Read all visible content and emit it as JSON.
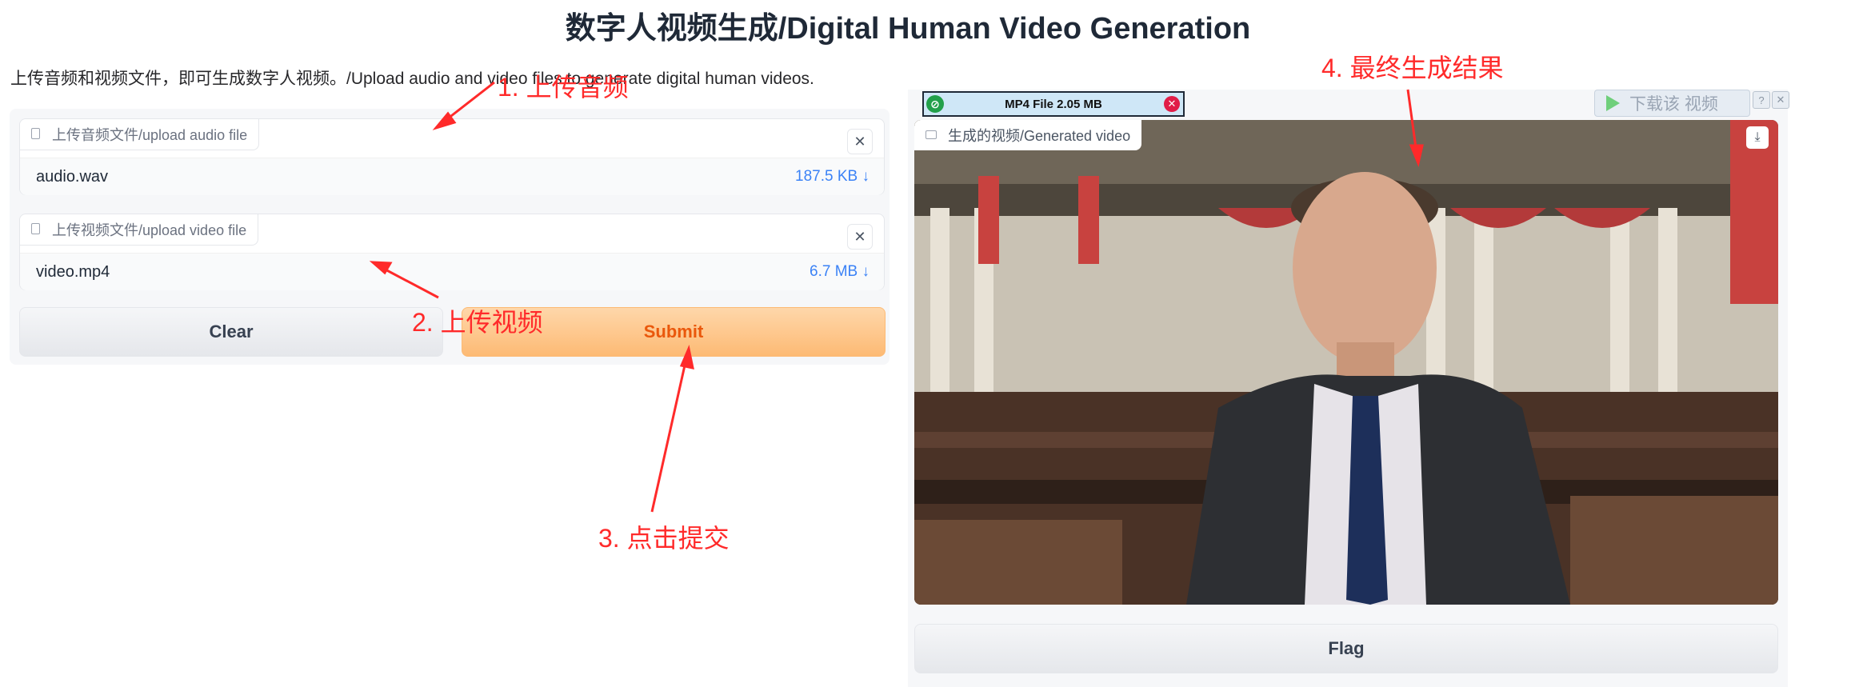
{
  "page": {
    "title": "数字人视频生成/Digital Human Video Generation",
    "description": "上传音频和视频文件，即可生成数字人视频。/Upload audio and video files to generate digital human videos."
  },
  "audio_input": {
    "label": "上传音频文件/upload audio file",
    "file_name": "audio.wav",
    "file_size": "187.5 KB ↓",
    "close_glyph": "✕"
  },
  "video_input": {
    "label": "上传视频文件/upload video file",
    "file_name": "video.mp4",
    "file_size": "6.7 MB ↓",
    "close_glyph": "✕"
  },
  "buttons": {
    "clear": "Clear",
    "submit": "Submit",
    "flag": "Flag"
  },
  "output": {
    "label": "生成的视频/Generated video",
    "download_glyph": "⤓"
  },
  "overlays": {
    "mp4_bar": "MP4 File 2.05 MB",
    "download_video": "下载该 视频",
    "help": "?",
    "close": "✕"
  },
  "annotations": {
    "step1": "1. 上传音频",
    "step2": "2. 上传视频",
    "step3": "3. 点击提交",
    "step4": "4. 最终生成结果"
  },
  "colors": {
    "annotation": "#ff2a2a",
    "submit_text": "#ea580c",
    "file_size": "#3b82f6"
  }
}
